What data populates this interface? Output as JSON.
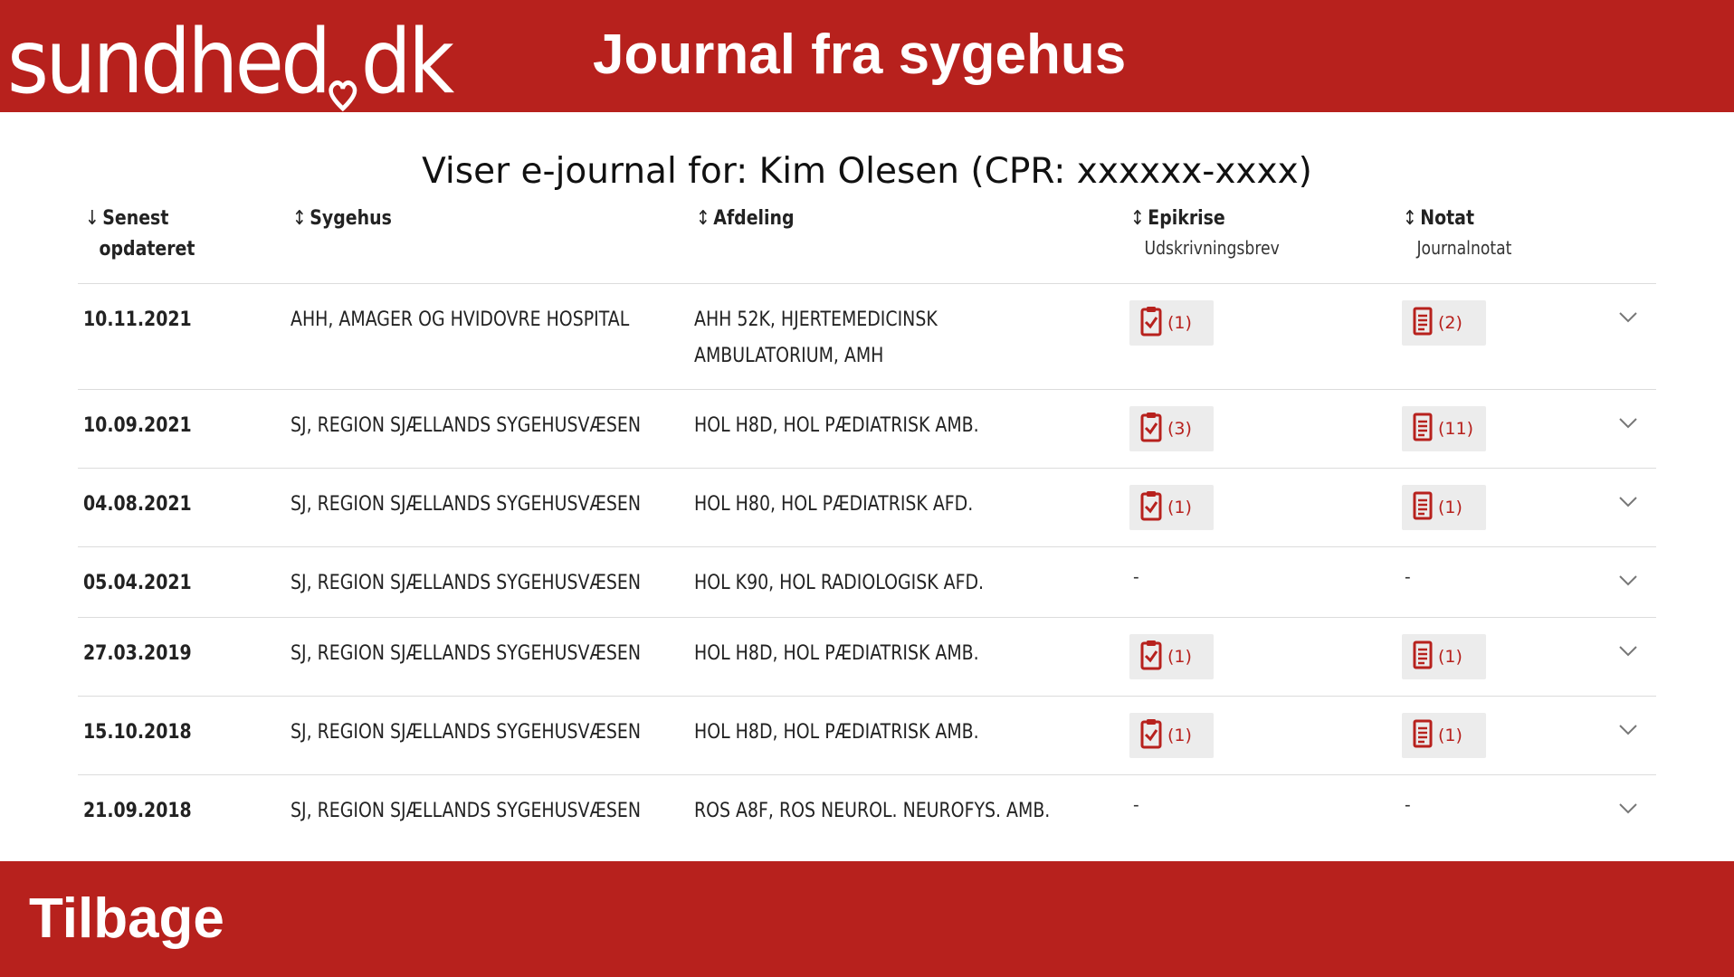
{
  "header": {
    "logo_text_left": "sundhed",
    "logo_text_right": "dk",
    "title": "Journal fra sygehus"
  },
  "subtitle": "Viser e-journal for: Kim Olesen  (CPR: xxxxxx-xxxx)",
  "table": {
    "columns": {
      "date_line1": "Senest",
      "date_line2": "opdateret",
      "date_arrow": "↓",
      "hospital": "Sygehus",
      "hospital_arrow": "↕",
      "department": "Afdeling",
      "department_arrow": "↕",
      "epikrise": "Epikrise",
      "epikrise_arrow": "↕",
      "epikrise_sub": "Udskrivningsbrev",
      "notat": "Notat",
      "notat_arrow": "↕",
      "notat_sub": "Journalnotat"
    },
    "rows": [
      {
        "date": "10.11.2021",
        "hospital": "AHH, AMAGER OG HVIDOVRE HOSPITAL",
        "department": "AHH 52K, HJERTEMEDICINSK AMBULATORIUM, AMH",
        "epikrise": "(1)",
        "notat": "(2)"
      },
      {
        "date": "10.09.2021",
        "hospital": "SJ, REGION SJÆLLANDS SYGEHUSVÆSEN",
        "department": "HOL H8D, HOL PÆDIATRISK AMB.",
        "epikrise": "(3)",
        "notat": "(11)"
      },
      {
        "date": "04.08.2021",
        "hospital": "SJ, REGION SJÆLLANDS SYGEHUSVÆSEN",
        "department": "HOL H80, HOL PÆDIATRISK AFD.",
        "epikrise": "(1)",
        "notat": "(1)"
      },
      {
        "date": "05.04.2021",
        "hospital": "SJ, REGION SJÆLLANDS SYGEHUSVÆSEN",
        "department": "HOL K90, HOL RADIOLOGISK AFD.",
        "epikrise": "-",
        "notat": "-"
      },
      {
        "date": "27.03.2019",
        "hospital": "SJ, REGION SJÆLLANDS SYGEHUSVÆSEN",
        "department": "HOL H8D, HOL PÆDIATRISK AMB.",
        "epikrise": "(1)",
        "notat": "(1)"
      },
      {
        "date": "15.10.2018",
        "hospital": "SJ, REGION SJÆLLANDS SYGEHUSVÆSEN",
        "department": "HOL H8D, HOL PÆDIATRISK AMB.",
        "epikrise": "(1)",
        "notat": "(1)"
      },
      {
        "date": "21.09.2018",
        "hospital": "SJ, REGION SJÆLLANDS SYGEHUSVÆSEN",
        "department": "ROS A8F, ROS NEUROL. NEUROFYS. AMB.",
        "epikrise": "-",
        "notat": "-"
      }
    ]
  },
  "footer": {
    "back_label": "Tilbage"
  },
  "colors": {
    "brand_red": "#b7211d",
    "button_bg": "#ececec"
  },
  "icons": {
    "epikrise": "clipboard-check-icon",
    "notat": "document-icon",
    "expand": "chevron-down-icon"
  }
}
